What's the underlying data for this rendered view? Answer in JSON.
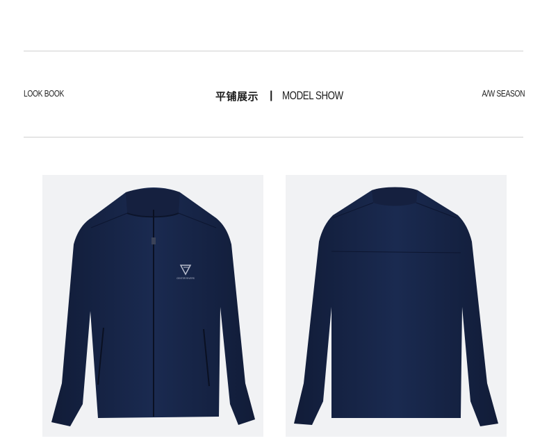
{
  "header": {
    "left_label": "LOOK BOOK",
    "center_cn": "平铺展示",
    "separator": "|",
    "center_en": "MODEL SHOW",
    "right_label": "A/W SEASON"
  },
  "photos": {
    "front": {
      "subject": "navy zip-up stand-collar jacket, front view",
      "logo_text": "CENTER RIVERS"
    },
    "back": {
      "subject": "navy stand-collar jacket, back view"
    }
  },
  "colors": {
    "jacket": "#172547",
    "photo_bg": "#f1f2f4",
    "rule": "#cfcfcf"
  }
}
